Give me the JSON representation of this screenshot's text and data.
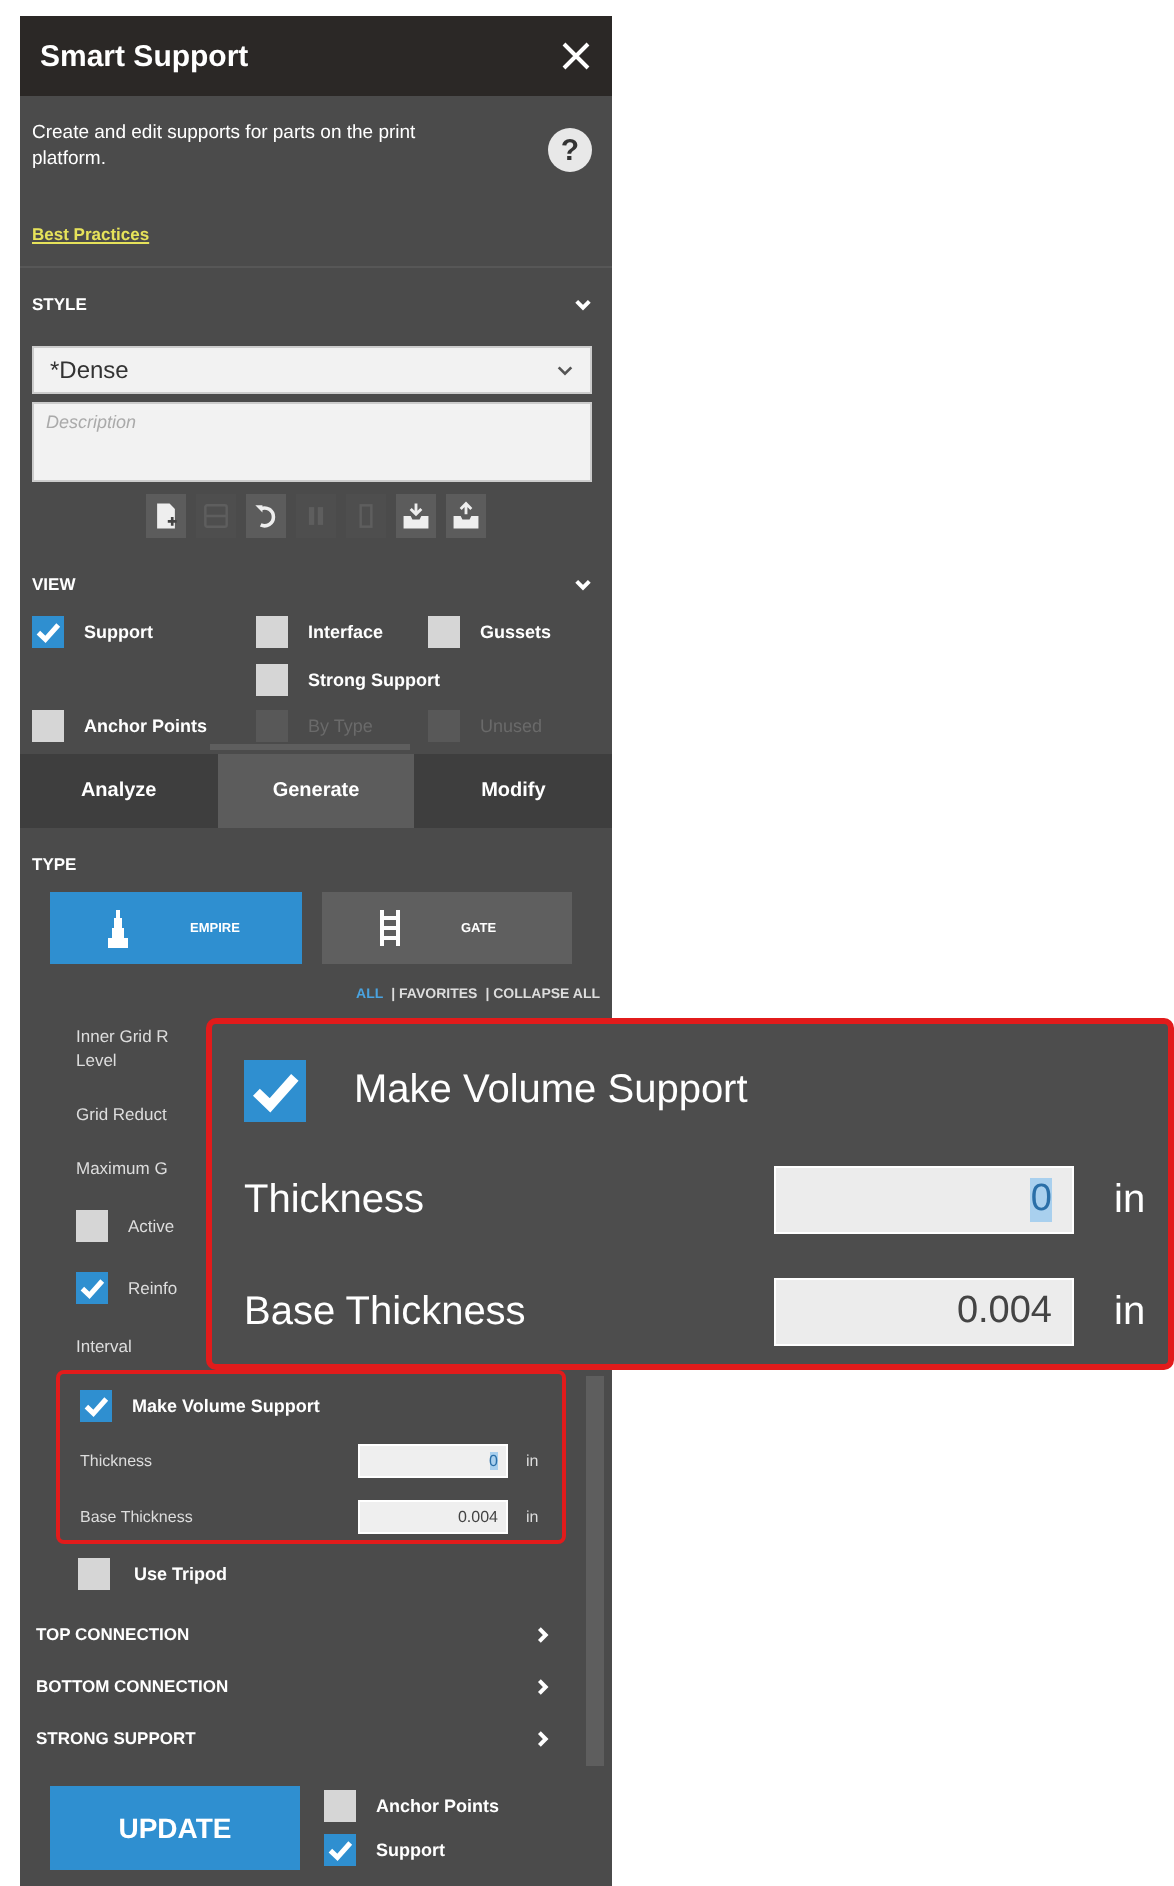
{
  "window": {
    "title": "Smart Support"
  },
  "intro": {
    "description": "Create and edit supports for parts on the print platform.",
    "help": "?",
    "link": "Best Practices"
  },
  "style": {
    "heading": "STYLE",
    "expanded": true,
    "selected_style": "*Dense",
    "description_placeholder": "Description",
    "toolbar": [
      {
        "kind": "new",
        "disabled": false
      },
      {
        "kind": "save",
        "disabled": true
      },
      {
        "kind": "undo",
        "disabled": false
      },
      {
        "kind": "copy",
        "disabled": true
      },
      {
        "kind": "delete",
        "disabled": true
      },
      {
        "kind": "import",
        "disabled": false
      },
      {
        "kind": "export",
        "disabled": false
      }
    ]
  },
  "view": {
    "heading": "VIEW",
    "expanded": true,
    "rows": [
      [
        {
          "label": "Support",
          "checked": true,
          "disabled": false
        },
        {
          "label": "Interface",
          "checked": false,
          "disabled": false
        },
        {
          "label": "Gussets",
          "checked": false,
          "disabled": false
        }
      ],
      [
        "",
        {
          "label": "Strong Support",
          "checked": false,
          "disabled": false
        },
        ""
      ],
      [
        {
          "label": "Anchor Points",
          "checked": false,
          "disabled": false
        },
        {
          "label": "By Type",
          "checked": false,
          "disabled": true
        },
        {
          "label": "Unused",
          "checked": false,
          "disabled": true
        }
      ]
    ]
  },
  "tabs": [
    {
      "label": "Analyze",
      "selected": false
    },
    {
      "label": "Generate",
      "selected": true
    },
    {
      "label": "Modify",
      "selected": false
    }
  ],
  "type": {
    "heading": "TYPE",
    "options": [
      {
        "label": "EMPIRE",
        "kind": "empire",
        "selected": true
      },
      {
        "label": "GATE",
        "kind": "gate",
        "selected": false
      }
    ],
    "filters": [
      {
        "label": "ALL",
        "selected": true
      },
      {
        "label": "| FAVORITES",
        "selected": false
      },
      {
        "label": "| COLLAPSE ALL",
        "selected": false
      }
    ]
  },
  "parameters": [
    {
      "kind": "text",
      "lines": [
        "Inner Grid R",
        "Level"
      ]
    },
    {
      "kind": "text",
      "lines": [
        "Grid Reduct"
      ]
    },
    {
      "kind": "text",
      "lines": [
        "Maximum G"
      ]
    },
    {
      "kind": "checkbox",
      "lines": [
        "Active"
      ],
      "checked": false
    },
    {
      "kind": "checkbox",
      "lines": [
        "Reinfo"
      ],
      "checked": true
    },
    {
      "kind": "text",
      "lines": [
        "Interval"
      ]
    }
  ],
  "volume_support": {
    "label": "Make Volume Support",
    "checked": true,
    "fields": [
      {
        "label": "Thickness",
        "value": "0",
        "value_highlighted": true,
        "unit": "in"
      },
      {
        "label": "Base Thickness",
        "value": "0.004",
        "value_highlighted": false,
        "unit": "in"
      }
    ]
  },
  "use_tripod": {
    "label": "Use Tripod",
    "checked": false
  },
  "sections": [
    {
      "label": "TOP CONNECTION",
      "expanded": false
    },
    {
      "label": "BOTTOM CONNECTION",
      "expanded": false
    },
    {
      "label": "STRONG SUPPORT",
      "expanded": false
    }
  ],
  "footer": {
    "button": "UPDATE",
    "options": [
      {
        "label": "Anchor Points",
        "checked": false
      },
      {
        "label": "Support",
        "checked": true
      }
    ]
  },
  "callout": {
    "label": "Make Volume Support",
    "checked": true,
    "fields": [
      {
        "label": "Thickness",
        "value": "0",
        "value_highlighted": true,
        "unit": "in"
      },
      {
        "label": "Base Thickness",
        "value": "0.004",
        "value_highlighted": false,
        "unit": "in"
      }
    ]
  }
}
